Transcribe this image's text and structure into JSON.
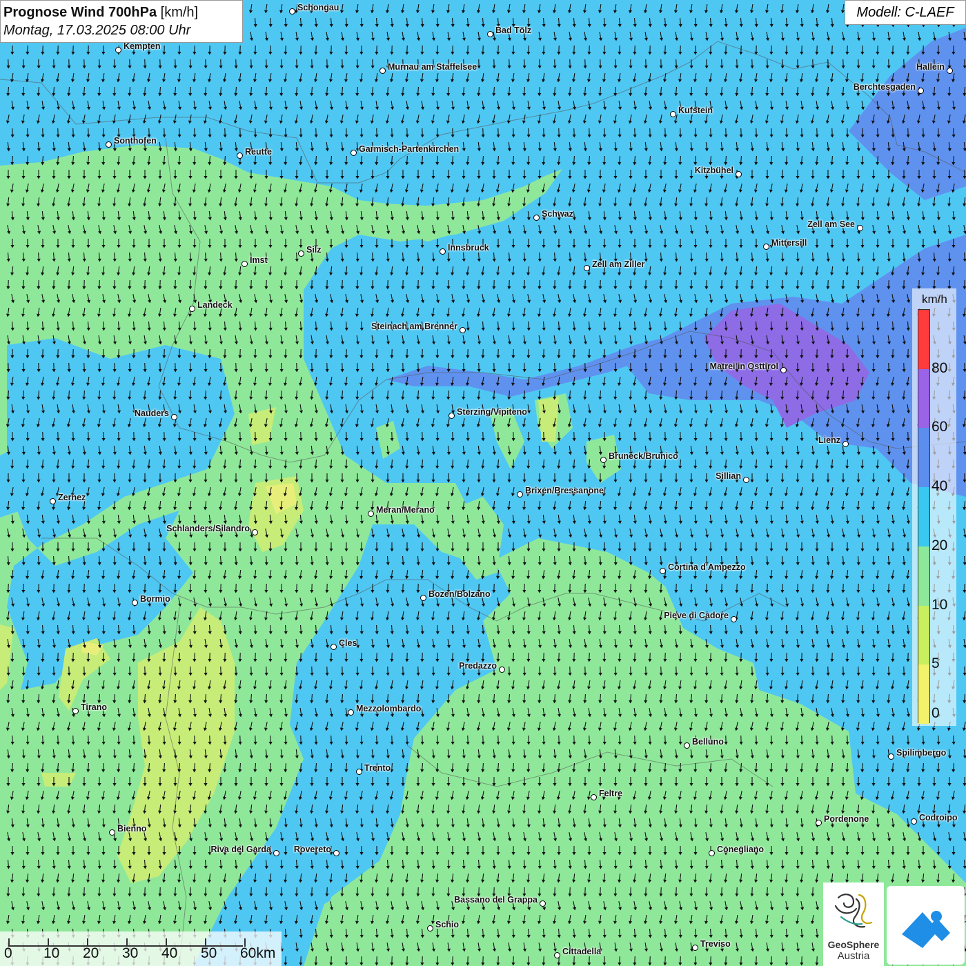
{
  "header": {
    "title_bold": "Prognose Wind 700hPa",
    "title_unit": "[km/h]",
    "subtitle": "Montag, 17.03.2025 08:00 Uhr"
  },
  "model_label": "Modell: C-LAEF",
  "legend": {
    "unit": "km/h",
    "ticks": [
      "0",
      "5",
      "10",
      "20",
      "40",
      "60",
      "80"
    ],
    "colors": [
      "#f3f26b",
      "#c9ee5e",
      "#8ee89a",
      "#38c8f0",
      "#5b8eef",
      "#9b63e8",
      "#ff3b3b"
    ]
  },
  "colors": {
    "wind_0_5": "#e7ef7a",
    "wind_5_10": "#c7ec78",
    "wind_10_20": "#8fe89a",
    "wind_20_40": "#4fc7f3",
    "wind_40_60": "#5f92ef",
    "wind_60_80": "#8d6ce6"
  },
  "wind_direction": "north-to-south arrows (southward flow)",
  "scalebar": {
    "labels": [
      "0",
      "10",
      "20",
      "30",
      "40",
      "50",
      "60km"
    ]
  },
  "logos": {
    "geosphere_line1": "GeoSphere",
    "geosphere_line2": "Austria"
  },
  "cities": [
    {
      "name": "Schongau",
      "side": "right"
    },
    {
      "name": "Bad Tölz",
      "side": "right"
    },
    {
      "name": "Kempten",
      "side": "right"
    },
    {
      "name": "Murnau am Staffelsee",
      "side": "right"
    },
    {
      "name": "Hallein",
      "side": "left"
    },
    {
      "name": "Berchtesgaden",
      "side": "left"
    },
    {
      "name": "Kufstein",
      "side": "right"
    },
    {
      "name": "Sonthofen",
      "side": "right"
    },
    {
      "name": "Reutte",
      "side": "right"
    },
    {
      "name": "Garmisch-Partenkirchen",
      "side": "right"
    },
    {
      "name": "Kitzbühel",
      "side": "left"
    },
    {
      "name": "Schwaz",
      "side": "right"
    },
    {
      "name": "Zell am See",
      "side": "left"
    },
    {
      "name": "Silz",
      "side": "right"
    },
    {
      "name": "Innsbruck",
      "side": "right"
    },
    {
      "name": "Mittersill",
      "side": "right"
    },
    {
      "name": "Imst",
      "side": "right"
    },
    {
      "name": "Zell am Ziller",
      "side": "right"
    },
    {
      "name": "Landeck",
      "side": "right"
    },
    {
      "name": "Steinach am Brenner",
      "side": "left"
    },
    {
      "name": "Matrei in Osttirol",
      "side": "left"
    },
    {
      "name": "Nauders",
      "side": "left"
    },
    {
      "name": "Sterzing/Vipiteno",
      "side": "right"
    },
    {
      "name": "Lienz",
      "side": "left"
    },
    {
      "name": "Bruneck/Brunico",
      "side": "right"
    },
    {
      "name": "Sillian",
      "side": "left"
    },
    {
      "name": "Brixen/Bressanone",
      "side": "right"
    },
    {
      "name": "Zernez",
      "side": "right"
    },
    {
      "name": "Meran/Merano",
      "side": "right"
    },
    {
      "name": "Schlanders/Silandro",
      "side": "left"
    },
    {
      "name": "Cortina d'Ampezzo",
      "side": "right"
    },
    {
      "name": "Bormio",
      "side": "right"
    },
    {
      "name": "Bozen/Bolzano",
      "side": "right"
    },
    {
      "name": "Pieve di Cadore",
      "side": "left"
    },
    {
      "name": "Cles",
      "side": "right"
    },
    {
      "name": "Predazzo",
      "side": "left"
    },
    {
      "name": "Tirano",
      "side": "right"
    },
    {
      "name": "Mezzolombardo",
      "side": "right"
    },
    {
      "name": "Belluno",
      "side": "right"
    },
    {
      "name": "Spilimbergo",
      "side": "right"
    },
    {
      "name": "Trento",
      "side": "right"
    },
    {
      "name": "Feltre",
      "side": "right"
    },
    {
      "name": "Pordenone",
      "side": "right"
    },
    {
      "name": "Codroipo",
      "side": "right"
    },
    {
      "name": "Bienno",
      "side": "right"
    },
    {
      "name": "Riva del Garda",
      "side": "left"
    },
    {
      "name": "Rovereto",
      "side": "left"
    },
    {
      "name": "Conegliano",
      "side": "right"
    },
    {
      "name": "Bassano del Grappa",
      "side": "left"
    },
    {
      "name": "Schio",
      "side": "right"
    },
    {
      "name": "Treviso",
      "side": "right"
    },
    {
      "name": "Cittadella",
      "side": "right"
    }
  ]
}
